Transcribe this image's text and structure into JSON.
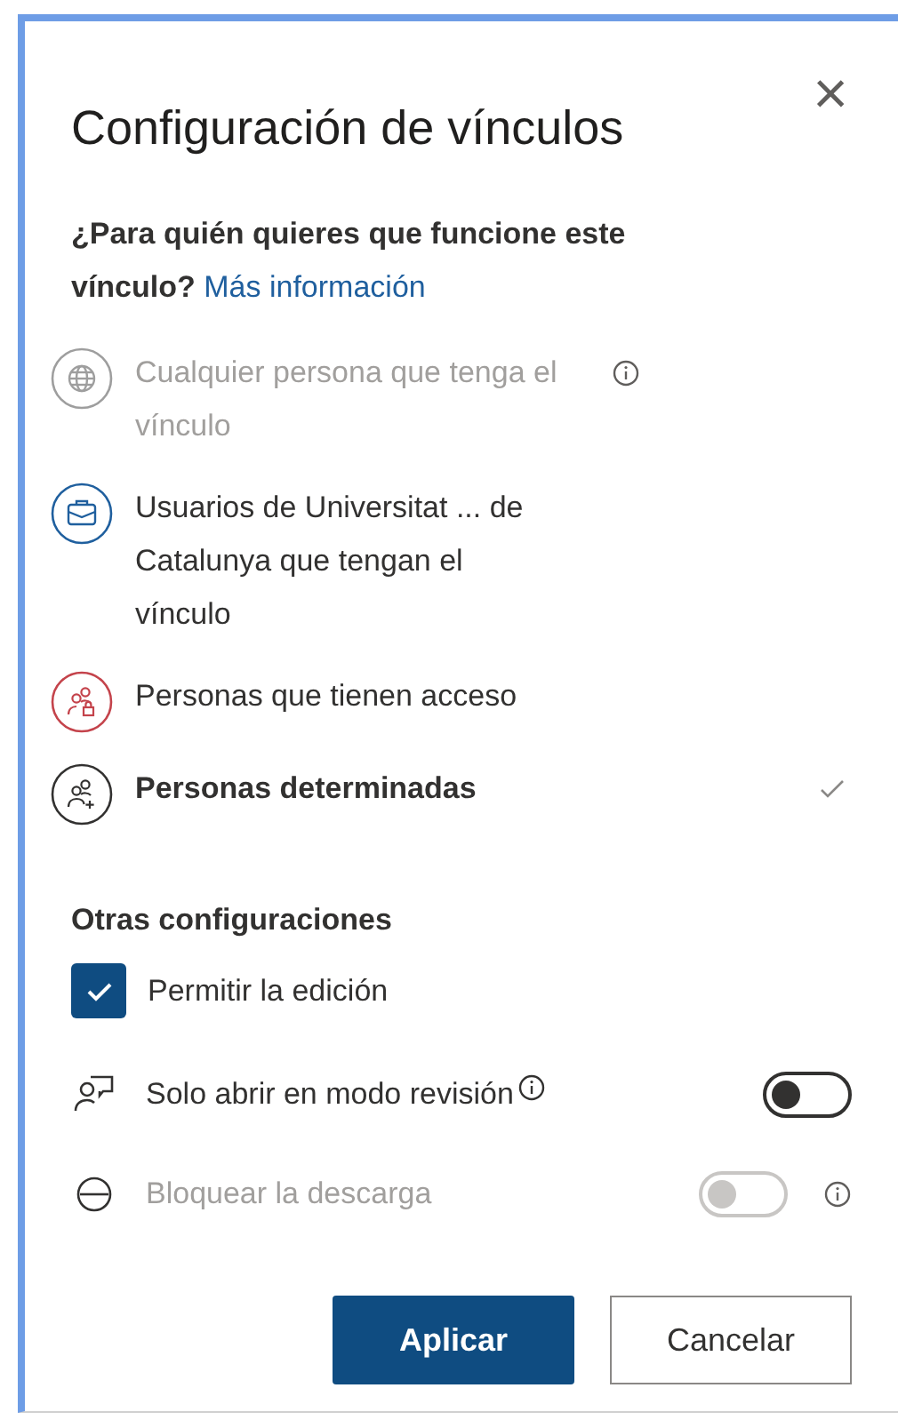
{
  "dialog": {
    "title": "Configuración de vínculos",
    "close_glyph": "×"
  },
  "audience": {
    "question": "¿Para quién quieres que funcione este vínculo?",
    "link": "Más información"
  },
  "options": [
    {
      "kind": "globe",
      "label": "Cualquier persona que tenga el vínculo",
      "color": "#9e9e9e",
      "disabled": true,
      "selected": false,
      "info": true
    },
    {
      "kind": "organization",
      "label": "Usuarios de Universitat ... de Catalunya que tengan el vínculo",
      "color": "#1f5f9e",
      "disabled": false,
      "selected": false,
      "info": false
    },
    {
      "kind": "people-lock",
      "label": "Personas que tienen acceso",
      "color": "#c4434b",
      "disabled": false,
      "selected": false,
      "info": false
    },
    {
      "kind": "people-add",
      "label": "Personas determinadas",
      "color": "#323130",
      "disabled": false,
      "selected": true,
      "info": false
    }
  ],
  "other": {
    "heading": "Otras configuraciones",
    "settings": [
      {
        "kind": "checkbox",
        "label": "Permitir la edición",
        "checked": true,
        "disabled": false
      },
      {
        "kind": "toggle",
        "label": "Solo abrir en modo revisión",
        "on": false,
        "disabled": false,
        "info": true
      },
      {
        "kind": "toggle",
        "label": "Bloquear la descarga",
        "on": false,
        "disabled": true,
        "info": true
      }
    ]
  },
  "buttons": [
    {
      "label": "Aplicar",
      "primary": true
    },
    {
      "label": "Cancelar",
      "primary": false
    }
  ]
}
